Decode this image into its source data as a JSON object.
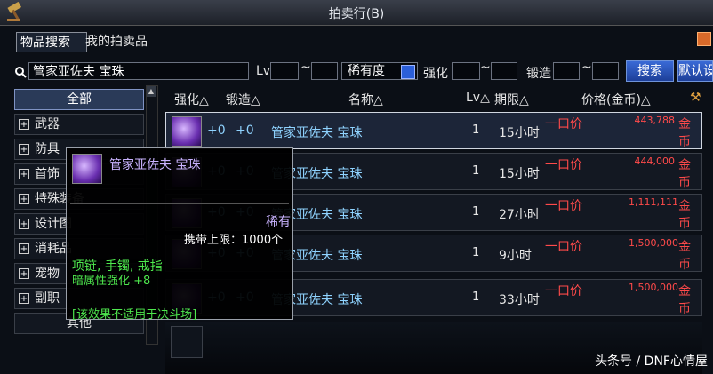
{
  "window": {
    "title": "拍卖行(B)"
  },
  "tabs": [
    {
      "label": "物品搜索",
      "active": true
    },
    {
      "label": "我的拍卖品",
      "active": false
    }
  ],
  "search": {
    "query": "管家亚佐夫 宝珠",
    "lv_label": "Lv",
    "range_sep": "~",
    "rarity_label": "稀有度",
    "enhance_label": "强化",
    "forge_label": "锻造",
    "search_button": "搜索",
    "default_button": "默认设"
  },
  "sidebar": {
    "items": [
      {
        "label": "全部",
        "active": true,
        "expandable": false
      },
      {
        "label": "武器",
        "expandable": true
      },
      {
        "label": "防具",
        "expandable": true
      },
      {
        "label": "首饰",
        "expandable": true
      },
      {
        "label": "特殊装备",
        "expandable": true
      },
      {
        "label": "设计图",
        "expandable": true
      },
      {
        "label": "消耗品",
        "expandable": true
      },
      {
        "label": "宠物",
        "expandable": true
      },
      {
        "label": "副职",
        "expandable": true
      },
      {
        "label": "其他",
        "expandable": false
      }
    ]
  },
  "columns": {
    "enhance": "强化△",
    "forge": "锻造△",
    "name": "名称△",
    "lv": "Lv△",
    "period": "期限△",
    "price": "价格(金币)△"
  },
  "rows": [
    {
      "enhance": "+0",
      "forge": "+0",
      "name": "管家亚佐夫  宝珠",
      "lv": "1",
      "time": "15小时",
      "buyout": "一口价",
      "price": "443,788",
      "currency": "金币",
      "selected": true
    },
    {
      "enhance": "+0",
      "forge": "+0",
      "name": "管家亚佐夫  宝珠",
      "lv": "1",
      "time": "15小时",
      "buyout": "一口价",
      "price": "444,000",
      "currency": "金币",
      "selected": false
    },
    {
      "enhance": "+0",
      "forge": "+0",
      "name": "管家亚佐夫  宝珠",
      "lv": "1",
      "time": "27小时",
      "buyout": "一口价",
      "price": "1,111,111",
      "currency": "金币",
      "selected": false
    },
    {
      "enhance": "+0",
      "forge": "+0",
      "name": "管家亚佐夫  宝珠",
      "lv": "1",
      "time": "9小时",
      "buyout": "一口价",
      "price": "1,500,000",
      "currency": "金币",
      "selected": false
    },
    {
      "enhance": "+0",
      "forge": "+0",
      "name": "管家亚佐夫  宝珠",
      "lv": "1",
      "time": "33小时",
      "buyout": "一口价",
      "price": "1,500,000",
      "currency": "金币",
      "selected": false
    }
  ],
  "tooltip": {
    "name": "管家亚佐夫  宝珠",
    "rarity": "稀有",
    "carry_limit": "携带上限：1000个",
    "slots": "项链, 手镯, 戒指",
    "stat": "暗属性强化 +8",
    "note": "[该效果不适用于决斗场]"
  },
  "watermark": "头条号 / DNF心情屋",
  "colors": {
    "price_red": "#ff4a4a",
    "name_blue": "#8fd3ff",
    "tooltip_green": "#4ee84e",
    "rarity_purple": "#c9b3ff"
  }
}
